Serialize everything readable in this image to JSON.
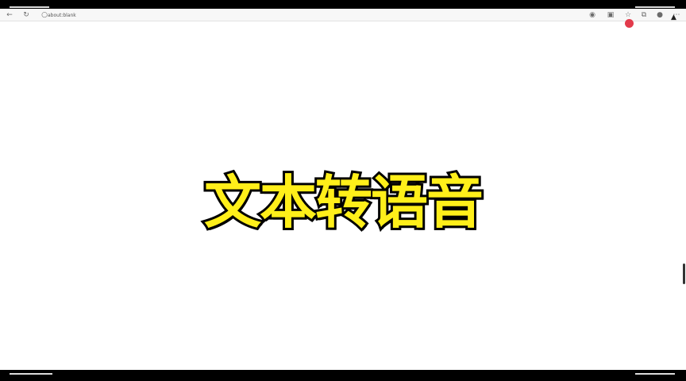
{
  "browser": {
    "address": "about:blank",
    "icons": [
      "back-icon",
      "refresh-icon",
      "info-icon",
      "tracking-icon",
      "reader-icon",
      "favorite-icon",
      "collections-icon",
      "profile-icon",
      "more-icon"
    ]
  },
  "page": {
    "headline": "文本转语音",
    "headline_color": "#ffef1a",
    "outline_color": "#000000"
  },
  "overlay": {
    "record_dot_color": "#e23a4b"
  }
}
